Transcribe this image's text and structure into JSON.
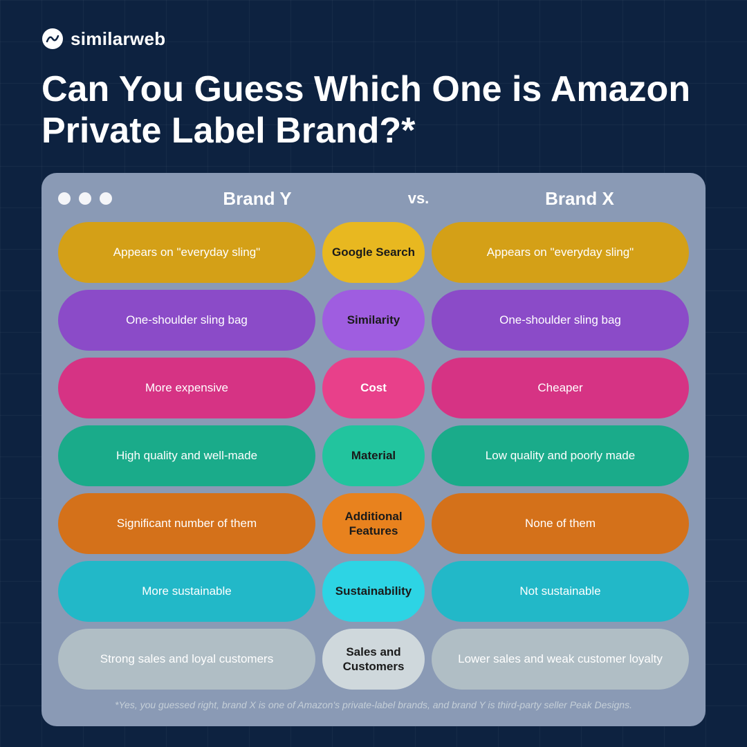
{
  "brand": {
    "logo_text": "similarweb"
  },
  "main_title": "Can You Guess Which One is Amazon Private Label Brand?*",
  "card": {
    "brand_y": "Brand Y",
    "vs": "vs.",
    "brand_x": "Brand X",
    "rows": [
      {
        "id": "google",
        "left": "Appears on \"everyday sling\"",
        "center": "Google Search",
        "right": "Appears on \"everyday sling\""
      },
      {
        "id": "similarity",
        "left": "One-shoulder sling bag",
        "center": "Similarity",
        "right": "One-shoulder sling bag"
      },
      {
        "id": "cost",
        "left": "More expensive",
        "center": "Cost",
        "right": "Cheaper"
      },
      {
        "id": "material",
        "left": "High quality and well-made",
        "center": "Material",
        "right": "Low quality and poorly made"
      },
      {
        "id": "features",
        "left": "Significant number of them",
        "center": "Additional Features",
        "right": "None of them"
      },
      {
        "id": "sustainability",
        "left": "More sustainable",
        "center": "Sustainability",
        "right": "Not sustainable"
      },
      {
        "id": "sales",
        "left": "Strong sales and loyal customers",
        "center": "Sales and Customers",
        "right": "Lower sales and weak customer loyalty"
      }
    ]
  },
  "footnote": "*Yes, you guessed right, brand X is one of Amazon's private-label brands, and brand Y is third-party seller Peak Designs."
}
